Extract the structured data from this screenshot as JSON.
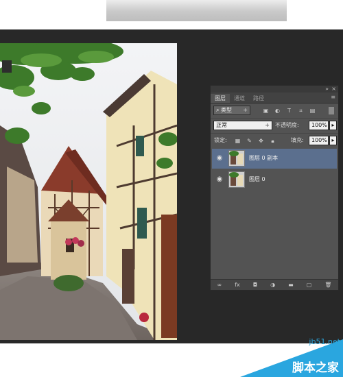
{
  "panel": {
    "tabs": [
      "图层",
      "通道",
      "路径"
    ],
    "filter_kind": "类型",
    "blend_mode": "正常",
    "opacity_label": "不透明度:",
    "opacity_value": "100%",
    "lock_label": "锁定:",
    "fill_label": "填充:",
    "fill_value": "100%",
    "layers": [
      {
        "name": "图层 0 副本",
        "selected": true
      },
      {
        "name": "图层 0",
        "selected": false
      }
    ],
    "footer_icons": [
      "link-icon",
      "fx-icon",
      "mask-icon",
      "adjustment-icon",
      "folder-icon",
      "new-layer-icon",
      "trash-icon"
    ]
  },
  "watermark": {
    "site": "jb51.net",
    "text": "脚本之家"
  },
  "colors": {
    "workspace": "#282828",
    "panel": "#535353",
    "selected_layer": "#5b6f8e",
    "watermark_blue": "#2aa6df"
  }
}
